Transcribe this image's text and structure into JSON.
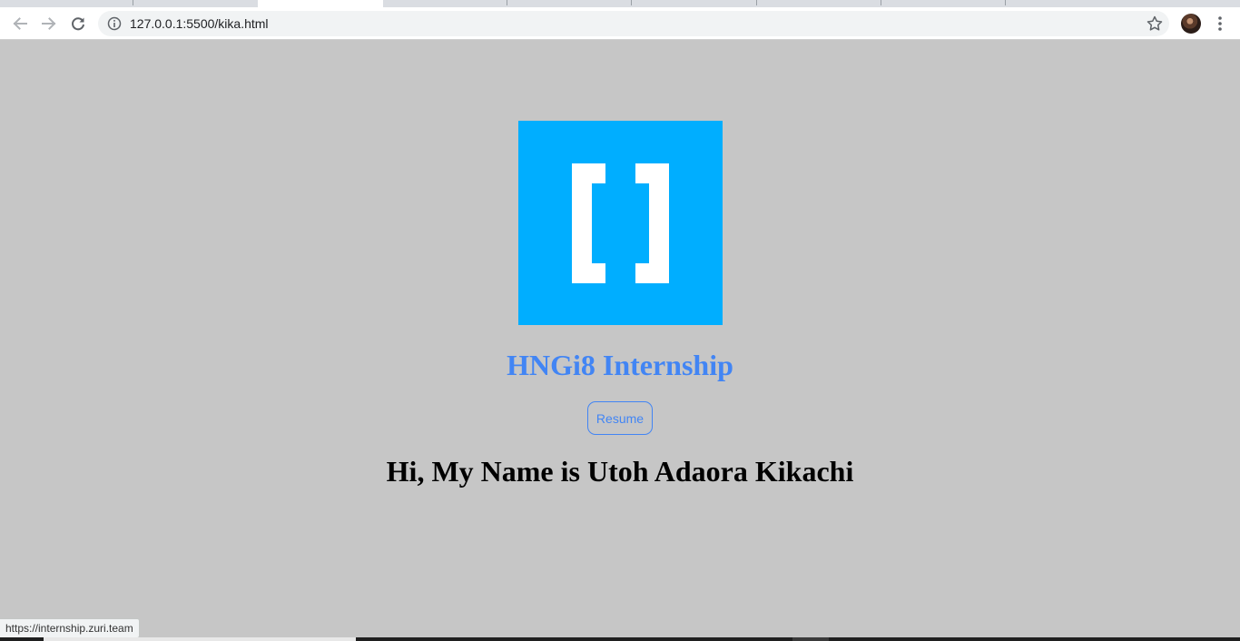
{
  "browser": {
    "address_bar": {
      "url": "127.0.0.1:5500/kika.html"
    },
    "icons": {
      "back": "arrow-left-icon",
      "forward": "arrow-right-icon",
      "reload": "reload-icon",
      "site_info": "info-icon",
      "bookmark": "star-icon",
      "menu": "kebab-menu-icon"
    },
    "status_url": "https://internship.zuri.team"
  },
  "page": {
    "logo": {
      "name": "bracket-logo-icon",
      "background_color": "#00aeff",
      "glyph_color": "#ffffff"
    },
    "headline": "HNGi8 Internship",
    "resume_button_label": "Resume",
    "greeting": "Hi, My Name is Utoh Adaora Kikachi"
  },
  "colors": {
    "page_background": "#c6c6c6",
    "accent_blue": "#4285f4",
    "logo_blue": "#00aeff",
    "greeting_text": "#000000"
  }
}
